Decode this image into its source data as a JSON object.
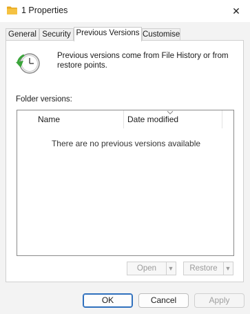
{
  "window": {
    "title": "1 Properties",
    "close_glyph": "✕"
  },
  "tabs": [
    {
      "label": "General"
    },
    {
      "label": "Security"
    },
    {
      "label": "Previous Versions"
    },
    {
      "label": "Customise"
    }
  ],
  "active_tab": "Previous Versions",
  "panel": {
    "info_text": "Previous versions come from File History or from restore points.",
    "section_label": "Folder versions:",
    "columns": {
      "name": "Name",
      "date": "Date modified"
    },
    "empty_message": "There are no previous versions available",
    "open_label": "Open",
    "restore_label": "Restore",
    "drop_glyph": "▼"
  },
  "footer": {
    "ok_label": "OK",
    "cancel_label": "Cancel",
    "apply_label": "Apply"
  },
  "icons": {
    "folder": "folder-icon",
    "clock": "history-clock-icon",
    "close": "close-icon"
  },
  "colors": {
    "accent": "#2e6fbd",
    "folder": "#f5c242",
    "clock_arrow": "#3aa53a"
  }
}
